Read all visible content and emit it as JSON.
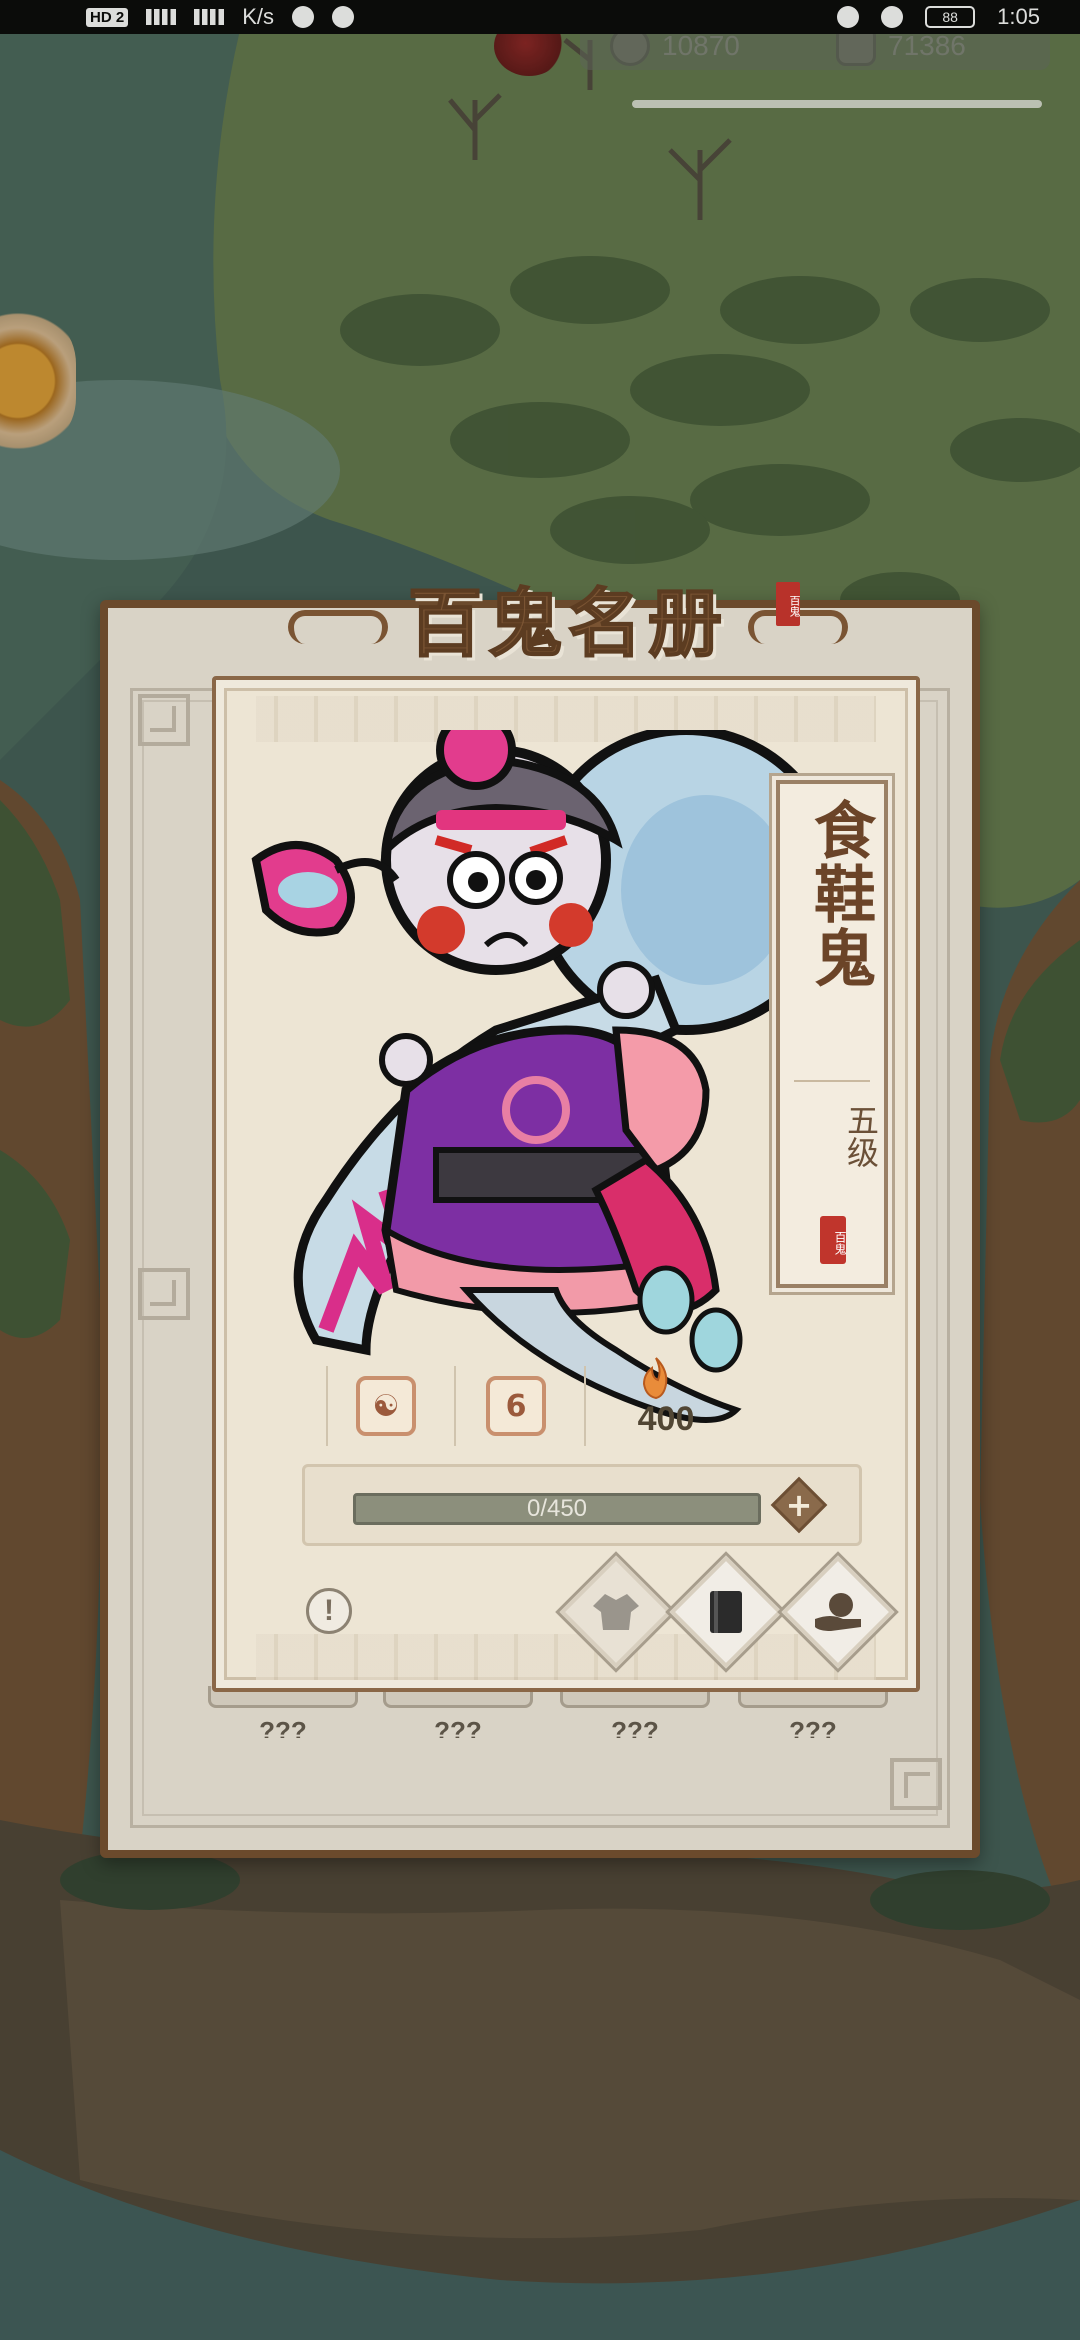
{
  "status_bar": {
    "hd_badge": "HD 2",
    "network_speed": "K/s",
    "time": "1:05",
    "battery": "88"
  },
  "resources": [
    {
      "icon": "copper-coin-icon",
      "value": "10870"
    },
    {
      "icon": "stone-icon",
      "value": "71386"
    }
  ],
  "register": {
    "title": "百鬼名册",
    "title_seal": "百鬼",
    "ghost": {
      "name": "食鞋鬼",
      "level": "五级",
      "seal": "百鬼",
      "stats": [
        {
          "icon": "yin-yang-icon",
          "value": ""
        },
        {
          "icon": "shield-level-icon",
          "value": "6"
        },
        {
          "icon": "flame-icon",
          "value": "400"
        }
      ],
      "exp": {
        "current": 0,
        "max": 450,
        "text": "0/450"
      }
    },
    "actions": [
      {
        "name": "outfit-button",
        "icon": "robe-icon"
      },
      {
        "name": "book-button",
        "icon": "book-icon"
      },
      {
        "name": "feed-button",
        "icon": "hand-bag-icon"
      }
    ],
    "slots": [
      "???",
      "???",
      "???",
      "???"
    ]
  },
  "colors": {
    "frame_brown": "#6b4a2c",
    "card_bg": "#ede5d4",
    "title_brown": "#7a5433",
    "seal_red": "#c0352c"
  }
}
